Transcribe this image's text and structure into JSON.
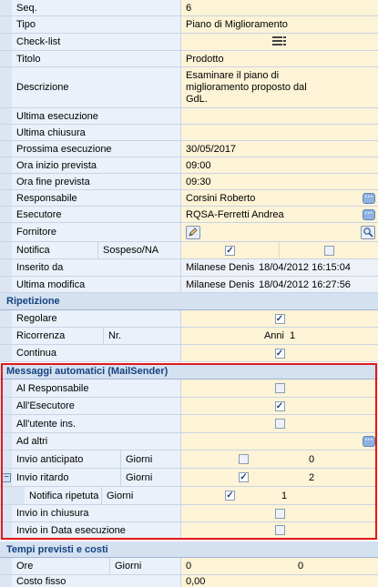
{
  "fields": {
    "seq": {
      "label": "Seq.",
      "value": "6"
    },
    "tipo": {
      "label": "Tipo",
      "value": "Piano di Miglioramento"
    },
    "checklist": {
      "label": "Check-list"
    },
    "titolo": {
      "label": "Titolo",
      "value": "Prodotto"
    },
    "descrizione": {
      "label": "Descrizione",
      "value": "Esaminare il piano di miglioramento proposto dal GdL."
    },
    "ultima_esecuzione": {
      "label": "Ultima esecuzione",
      "value": ""
    },
    "ultima_chiusura": {
      "label": "Ultima chiusura",
      "value": ""
    },
    "prossima_esecuzione": {
      "label": "Prossima esecuzione",
      "value": "30/05/2017"
    },
    "ora_inizio": {
      "label": "Ora inizio prevista",
      "value": "09:00"
    },
    "ora_fine": {
      "label": "Ora fine prevista",
      "value": "09:30"
    },
    "responsabile": {
      "label": "Responsabile",
      "value": "Corsini Roberto"
    },
    "esecutore": {
      "label": "Esecutore",
      "value": "RQSA-Ferretti Andrea"
    },
    "fornitore": {
      "label": "Fornitore"
    },
    "notifica": {
      "label": "Notifica",
      "sublabel": "Sospeso/NA",
      "checked": true,
      "sospeso": false
    },
    "inserito_da": {
      "label": "Inserito da",
      "user": "Milanese Denis",
      "datetime": "18/04/2012 16:15:04"
    },
    "ultima_modifica": {
      "label": "Ultima modifica",
      "user": "Milanese Denis",
      "datetime": "18/04/2012 16:27:56"
    }
  },
  "ripetizione": {
    "title": "Ripetizione",
    "regolare": {
      "label": "Regolare",
      "checked": true
    },
    "ricorrenza": {
      "label": "Ricorrenza",
      "sublabel": "Nr.",
      "unit": "Anni",
      "value": "1"
    },
    "continua": {
      "label": "Continua",
      "checked": true
    }
  },
  "mailsender": {
    "title": "Messaggi automatici (MailSender)",
    "al_responsabile": {
      "label": "Al Responsabile",
      "checked": false
    },
    "all_esecutore": {
      "label": "All'Esecutore",
      "checked": true
    },
    "all_utente": {
      "label": "All'utente ins.",
      "checked": false
    },
    "ad_altri": {
      "label": "Ad altri"
    },
    "invio_anticipato": {
      "label": "Invio anticipato",
      "sublabel": "Giorni",
      "checked": false,
      "value": "0"
    },
    "invio_ritardo": {
      "label": "Invio ritardo",
      "sublabel": "Giorni",
      "checked": true,
      "value": "2"
    },
    "notifica_ripetuta": {
      "label": "Notifica ripetuta",
      "sublabel": "Giorni",
      "checked": true,
      "value": "1"
    },
    "invio_chiusura": {
      "label": "Invio in chiusura",
      "checked": false
    },
    "invio_data_esecuzione": {
      "label": "Invio in Data esecuzione",
      "checked": false
    }
  },
  "tempi": {
    "title": "Tempi previsti e costi",
    "ore": {
      "label": "Ore",
      "sublabel": "Giorni",
      "value1": "0",
      "value2": "0"
    },
    "costo_fisso": {
      "label": "Costo fisso",
      "value": "0,00"
    }
  },
  "colors": {
    "label_bg": "#eaf1fa",
    "value_bg": "#fdf3d6",
    "section_bg": "#d4e1f1",
    "highlight_border": "#e0191b"
  }
}
